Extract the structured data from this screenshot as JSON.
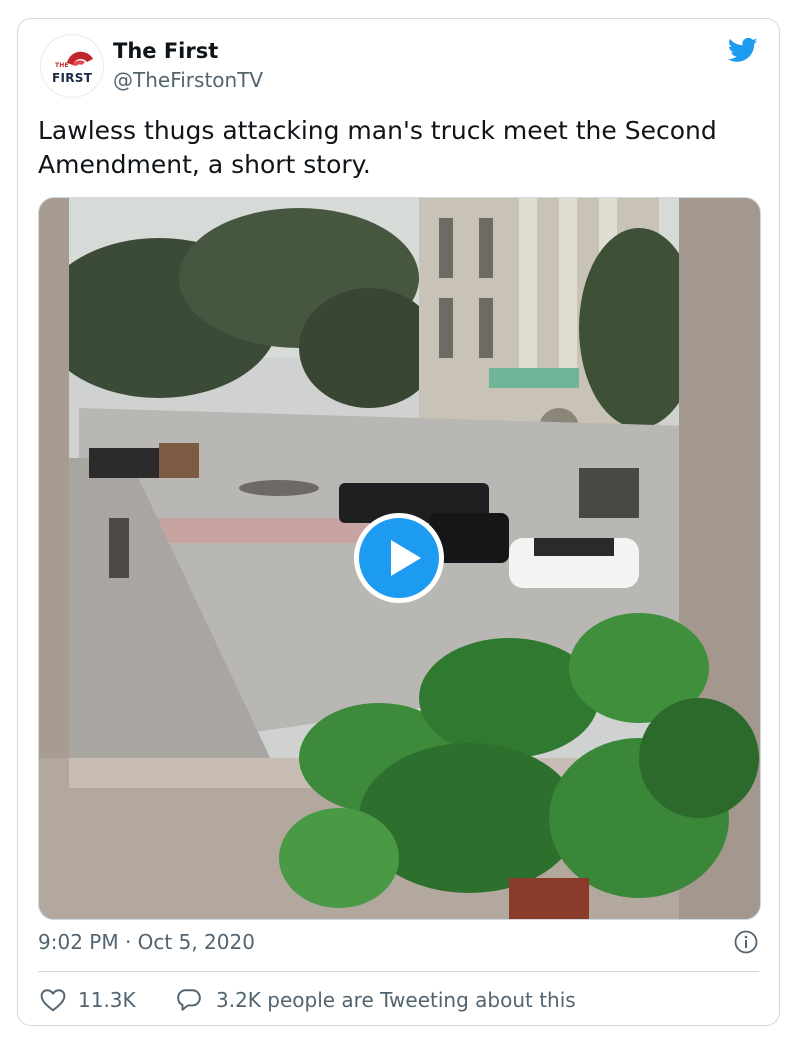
{
  "author": {
    "name": "The First",
    "handle": "@TheFirstonTV",
    "avatar_the": "THE",
    "avatar_first": "FIRST"
  },
  "tweet": {
    "text": "Lawless thugs attacking man's truck meet the Second Amendment, a short story.",
    "timestamp": "9:02 PM · Oct 5, 2020"
  },
  "engagement": {
    "likes": "11.3K",
    "tweeting": "3.2K people are Tweeting about this"
  },
  "icons": [
    "twitter-bird-icon",
    "play-icon",
    "info-icon",
    "heart-icon",
    "reply-bubble-icon"
  ],
  "colors": {
    "twitter_blue": "#1d9bf0",
    "secondary_text": "#536471",
    "border": "#cfd9de",
    "logo_red": "#c0262c"
  }
}
